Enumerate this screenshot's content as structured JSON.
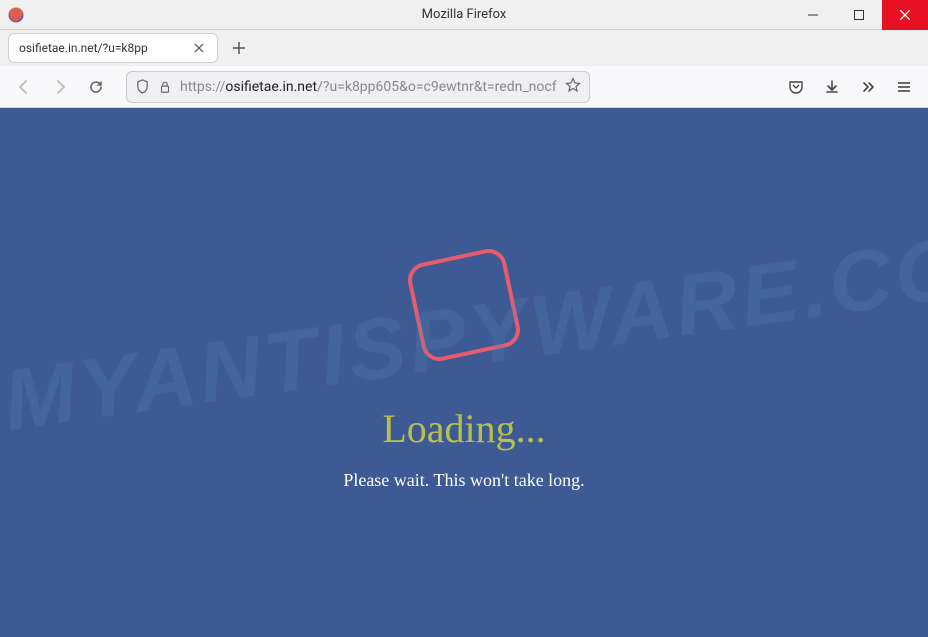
{
  "window": {
    "title": "Mozilla Firefox"
  },
  "tab": {
    "label": "osifietae.in.net/?u=k8pp"
  },
  "urlbar": {
    "protocol": "https://",
    "domain": "osifietae.in.net",
    "path": "/?u=k8pp605&o=c9ewtnr&t=redn_nocf"
  },
  "page": {
    "loading_title": "Loading...",
    "loading_subtitle": "Please wait. This won't take long."
  },
  "watermark": "MYANTISPYWARE.COM"
}
